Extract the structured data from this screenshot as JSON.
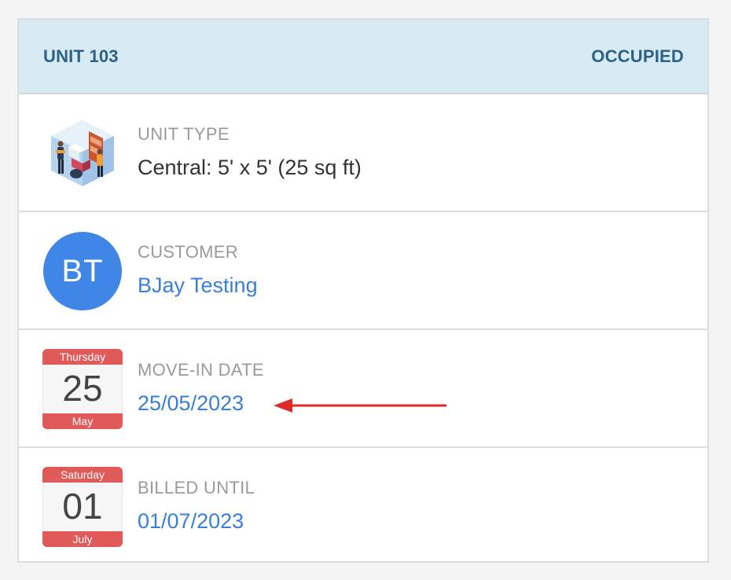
{
  "header": {
    "unit": "UNIT 103",
    "status": "OCCUPIED"
  },
  "unit_type": {
    "label": "UNIT TYPE",
    "value": "Central: 5' x 5' (25 sq ft)",
    "icon": "storage-unit-illustration-icon"
  },
  "customer": {
    "label": "CUSTOMER",
    "initials": "BT",
    "name": "BJay Testing"
  },
  "move_in": {
    "label": "MOVE-IN DATE",
    "value": "25/05/2023",
    "calendar": {
      "weekday": "Thursday",
      "day": "25",
      "month": "May"
    }
  },
  "billed_until": {
    "label": "BILLED UNTIL",
    "value": "01/07/2023",
    "calendar": {
      "weekday": "Saturday",
      "day": "01",
      "month": "July"
    }
  },
  "colors": {
    "header_bg": "#d8ebf5",
    "header_text": "#2b6184",
    "link": "#3a7fd4",
    "avatar": "#3f86e6",
    "calendar_accent": "#e05a5a",
    "annotation_arrow": "#e02a2a"
  }
}
